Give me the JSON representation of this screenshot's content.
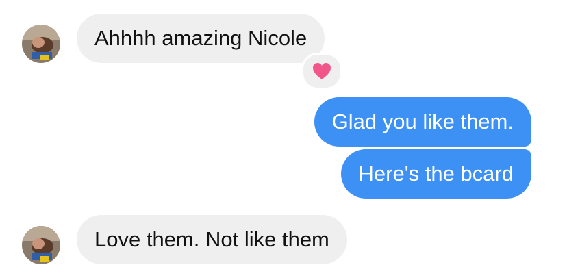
{
  "conversation": {
    "messages": [
      {
        "direction": "incoming",
        "text": "Ahhhh amazing Nicole",
        "reaction": "heart-icon"
      },
      {
        "direction": "outgoing",
        "text": "Glad you like them."
      },
      {
        "direction": "outgoing",
        "text": "Here's the bcard"
      },
      {
        "direction": "incoming",
        "text": "Love them. Not like them"
      }
    ]
  },
  "colors": {
    "incoming_bubble": "#efefef",
    "outgoing_bubble": "#3d91f5",
    "heart": "#f0568a"
  }
}
